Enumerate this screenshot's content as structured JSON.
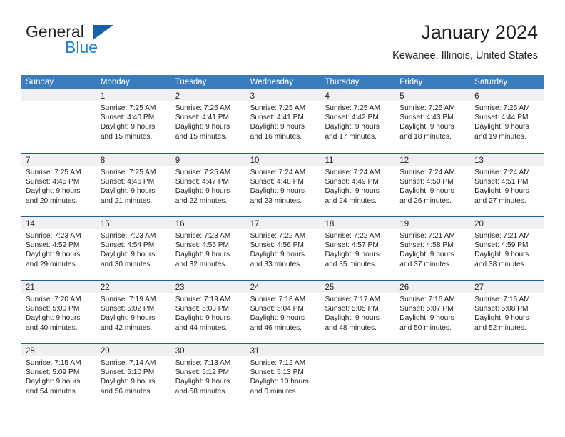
{
  "brand": {
    "word1": "General",
    "word2": "Blue",
    "triangle_color": "#1464a5",
    "blue_color": "#1b7fd4"
  },
  "header": {
    "month_title": "January 2024",
    "location": "Kewanee, Illinois, United States"
  },
  "theme": {
    "header_row_bg": "#3a7cbe",
    "week_divider": "#1f5fa0",
    "day_number_band": "#f0f0f0",
    "text": "#231f20"
  },
  "weekdays": [
    "Sunday",
    "Monday",
    "Tuesday",
    "Wednesday",
    "Thursday",
    "Friday",
    "Saturday"
  ],
  "weeks": [
    [
      {
        "num": "",
        "l1": "",
        "l2": "",
        "l3": "",
        "l4": ""
      },
      {
        "num": "1",
        "l1": "Sunrise: 7:25 AM",
        "l2": "Sunset: 4:40 PM",
        "l3": "Daylight: 9 hours",
        "l4": "and 15 minutes."
      },
      {
        "num": "2",
        "l1": "Sunrise: 7:25 AM",
        "l2": "Sunset: 4:41 PM",
        "l3": "Daylight: 9 hours",
        "l4": "and 15 minutes."
      },
      {
        "num": "3",
        "l1": "Sunrise: 7:25 AM",
        "l2": "Sunset: 4:41 PM",
        "l3": "Daylight: 9 hours",
        "l4": "and 16 minutes."
      },
      {
        "num": "4",
        "l1": "Sunrise: 7:25 AM",
        "l2": "Sunset: 4:42 PM",
        "l3": "Daylight: 9 hours",
        "l4": "and 17 minutes."
      },
      {
        "num": "5",
        "l1": "Sunrise: 7:25 AM",
        "l2": "Sunset: 4:43 PM",
        "l3": "Daylight: 9 hours",
        "l4": "and 18 minutes."
      },
      {
        "num": "6",
        "l1": "Sunrise: 7:25 AM",
        "l2": "Sunset: 4:44 PM",
        "l3": "Daylight: 9 hours",
        "l4": "and 19 minutes."
      }
    ],
    [
      {
        "num": "7",
        "l1": "Sunrise: 7:25 AM",
        "l2": "Sunset: 4:45 PM",
        "l3": "Daylight: 9 hours",
        "l4": "and 20 minutes."
      },
      {
        "num": "8",
        "l1": "Sunrise: 7:25 AM",
        "l2": "Sunset: 4:46 PM",
        "l3": "Daylight: 9 hours",
        "l4": "and 21 minutes."
      },
      {
        "num": "9",
        "l1": "Sunrise: 7:25 AM",
        "l2": "Sunset: 4:47 PM",
        "l3": "Daylight: 9 hours",
        "l4": "and 22 minutes."
      },
      {
        "num": "10",
        "l1": "Sunrise: 7:24 AM",
        "l2": "Sunset: 4:48 PM",
        "l3": "Daylight: 9 hours",
        "l4": "and 23 minutes."
      },
      {
        "num": "11",
        "l1": "Sunrise: 7:24 AM",
        "l2": "Sunset: 4:49 PM",
        "l3": "Daylight: 9 hours",
        "l4": "and 24 minutes."
      },
      {
        "num": "12",
        "l1": "Sunrise: 7:24 AM",
        "l2": "Sunset: 4:50 PM",
        "l3": "Daylight: 9 hours",
        "l4": "and 26 minutes."
      },
      {
        "num": "13",
        "l1": "Sunrise: 7:24 AM",
        "l2": "Sunset: 4:51 PM",
        "l3": "Daylight: 9 hours",
        "l4": "and 27 minutes."
      }
    ],
    [
      {
        "num": "14",
        "l1": "Sunrise: 7:23 AM",
        "l2": "Sunset: 4:52 PM",
        "l3": "Daylight: 9 hours",
        "l4": "and 29 minutes."
      },
      {
        "num": "15",
        "l1": "Sunrise: 7:23 AM",
        "l2": "Sunset: 4:54 PM",
        "l3": "Daylight: 9 hours",
        "l4": "and 30 minutes."
      },
      {
        "num": "16",
        "l1": "Sunrise: 7:23 AM",
        "l2": "Sunset: 4:55 PM",
        "l3": "Daylight: 9 hours",
        "l4": "and 32 minutes."
      },
      {
        "num": "17",
        "l1": "Sunrise: 7:22 AM",
        "l2": "Sunset: 4:56 PM",
        "l3": "Daylight: 9 hours",
        "l4": "and 33 minutes."
      },
      {
        "num": "18",
        "l1": "Sunrise: 7:22 AM",
        "l2": "Sunset: 4:57 PM",
        "l3": "Daylight: 9 hours",
        "l4": "and 35 minutes."
      },
      {
        "num": "19",
        "l1": "Sunrise: 7:21 AM",
        "l2": "Sunset: 4:58 PM",
        "l3": "Daylight: 9 hours",
        "l4": "and 37 minutes."
      },
      {
        "num": "20",
        "l1": "Sunrise: 7:21 AM",
        "l2": "Sunset: 4:59 PM",
        "l3": "Daylight: 9 hours",
        "l4": "and 38 minutes."
      }
    ],
    [
      {
        "num": "21",
        "l1": "Sunrise: 7:20 AM",
        "l2": "Sunset: 5:00 PM",
        "l3": "Daylight: 9 hours",
        "l4": "and 40 minutes."
      },
      {
        "num": "22",
        "l1": "Sunrise: 7:19 AM",
        "l2": "Sunset: 5:02 PM",
        "l3": "Daylight: 9 hours",
        "l4": "and 42 minutes."
      },
      {
        "num": "23",
        "l1": "Sunrise: 7:19 AM",
        "l2": "Sunset: 5:03 PM",
        "l3": "Daylight: 9 hours",
        "l4": "and 44 minutes."
      },
      {
        "num": "24",
        "l1": "Sunrise: 7:18 AM",
        "l2": "Sunset: 5:04 PM",
        "l3": "Daylight: 9 hours",
        "l4": "and 46 minutes."
      },
      {
        "num": "25",
        "l1": "Sunrise: 7:17 AM",
        "l2": "Sunset: 5:05 PM",
        "l3": "Daylight: 9 hours",
        "l4": "and 48 minutes."
      },
      {
        "num": "26",
        "l1": "Sunrise: 7:16 AM",
        "l2": "Sunset: 5:07 PM",
        "l3": "Daylight: 9 hours",
        "l4": "and 50 minutes."
      },
      {
        "num": "27",
        "l1": "Sunrise: 7:16 AM",
        "l2": "Sunset: 5:08 PM",
        "l3": "Daylight: 9 hours",
        "l4": "and 52 minutes."
      }
    ],
    [
      {
        "num": "28",
        "l1": "Sunrise: 7:15 AM",
        "l2": "Sunset: 5:09 PM",
        "l3": "Daylight: 9 hours",
        "l4": "and 54 minutes."
      },
      {
        "num": "29",
        "l1": "Sunrise: 7:14 AM",
        "l2": "Sunset: 5:10 PM",
        "l3": "Daylight: 9 hours",
        "l4": "and 56 minutes."
      },
      {
        "num": "30",
        "l1": "Sunrise: 7:13 AM",
        "l2": "Sunset: 5:12 PM",
        "l3": "Daylight: 9 hours",
        "l4": "and 58 minutes."
      },
      {
        "num": "31",
        "l1": "Sunrise: 7:12 AM",
        "l2": "Sunset: 5:13 PM",
        "l3": "Daylight: 10 hours",
        "l4": "and 0 minutes."
      },
      {
        "num": "",
        "l1": "",
        "l2": "",
        "l3": "",
        "l4": ""
      },
      {
        "num": "",
        "l1": "",
        "l2": "",
        "l3": "",
        "l4": ""
      },
      {
        "num": "",
        "l1": "",
        "l2": "",
        "l3": "",
        "l4": ""
      }
    ]
  ]
}
